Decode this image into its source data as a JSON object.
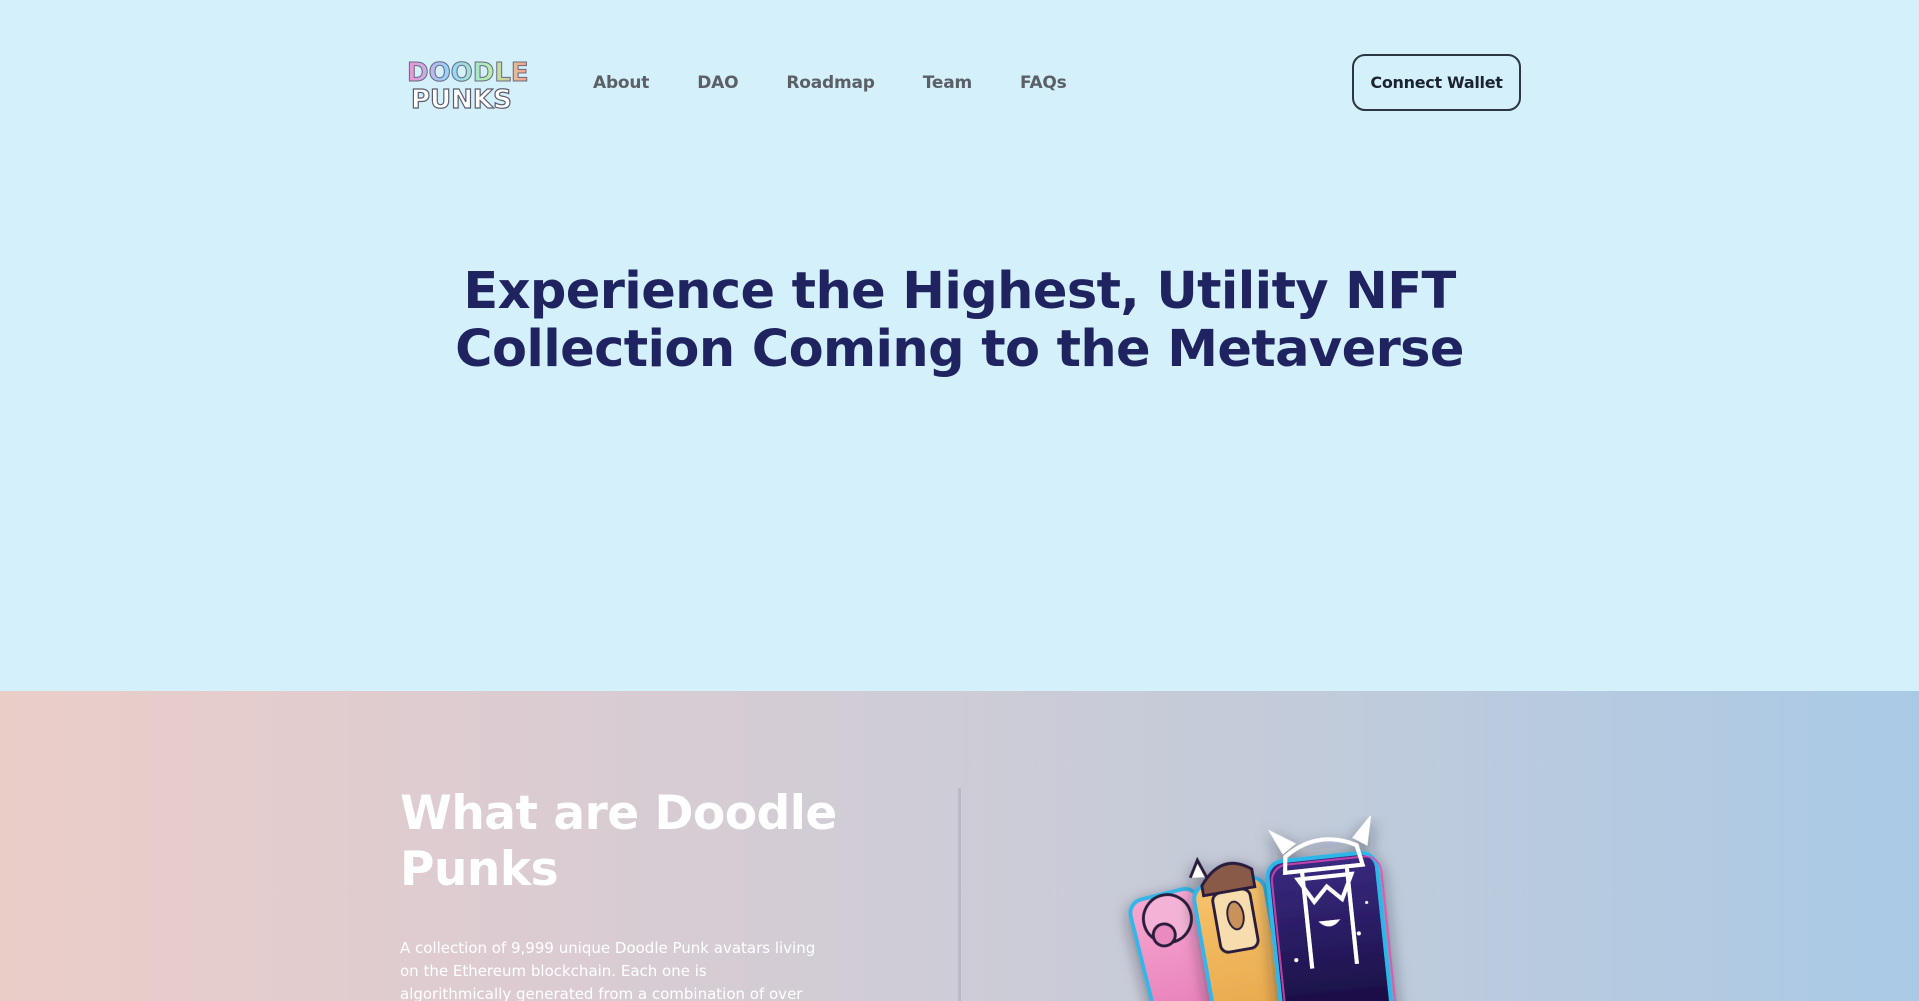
{
  "brand": {
    "logo_line1": "DOODLE",
    "logo_line2": "PUNKS"
  },
  "nav": {
    "items": [
      {
        "label": "About"
      },
      {
        "label": "DAO"
      },
      {
        "label": "Roadmap"
      },
      {
        "label": "Team"
      },
      {
        "label": "FAQs"
      }
    ],
    "connect_label": "Connect Wallet"
  },
  "hero": {
    "headline_line1": "Experience the Highest, Utility NFT",
    "headline_line2": "Collection Coming to the Metaverse"
  },
  "about": {
    "title_line1": "What are Doodle",
    "title_line2": "Punks",
    "text": "A collection of 9,999 unique Doodle Punk avatars living on the Ethereum blockchain. Each one is algorithmically generated from a combination of over"
  },
  "colors": {
    "hero_bg": "#d4f0fb",
    "headline": "#1f2461",
    "nav_text": "#5b5f66",
    "button_border": "#2c3542"
  }
}
